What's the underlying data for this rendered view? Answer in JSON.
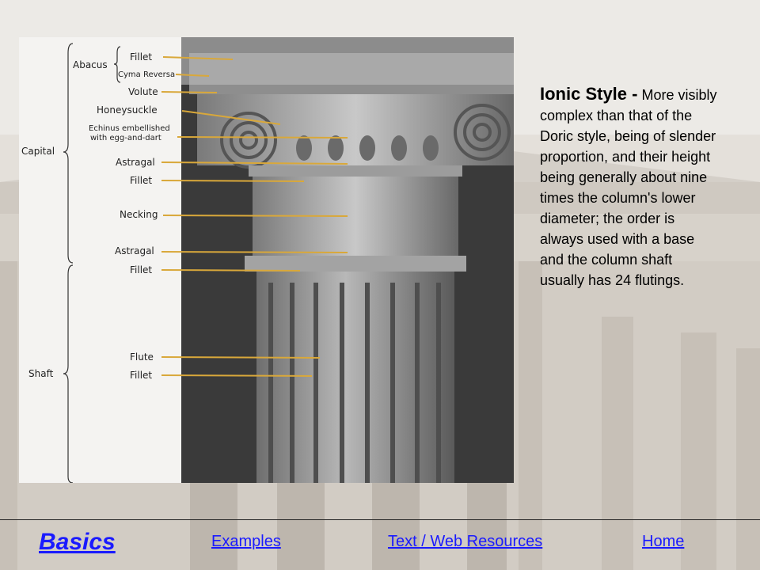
{
  "diagram": {
    "group_labels": [
      "Capital",
      "Shaft"
    ],
    "abacus_label": "Abacus",
    "part_labels": [
      "Fillet",
      "Cyma Reversa",
      "Volute",
      "Honeysuckle",
      "Echinus embellished",
      "with egg-and-dart",
      "Astragal",
      "Fillet",
      "Necking",
      "Astragal",
      "Fillet",
      "Flute",
      "Fillet"
    ],
    "leader_color": "#d9a83a"
  },
  "description": {
    "term": "Ionic Style -",
    "body": "More visibly complex than that of the Doric style, being of slender proportion, and their height being generally about nine times the column's lower diameter; the order is always used with a base and the column shaft usually has 24 flutings."
  },
  "footer": {
    "basics": "Basics",
    "examples": "Examples",
    "resources": "Text / Web Resources",
    "home": "Home"
  },
  "colors": {
    "link": "#1a1aff"
  }
}
